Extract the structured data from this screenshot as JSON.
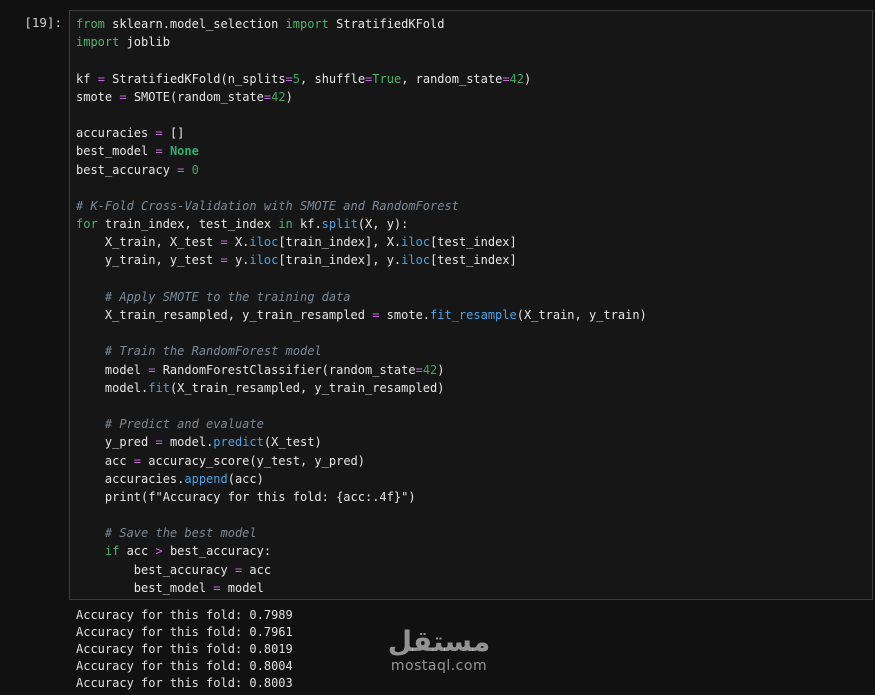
{
  "cell": {
    "prompt": "[19]:",
    "code_lines": [
      [
        [
          "kwc",
          "from"
        ],
        [
          "nm",
          " sklearn.model_selection "
        ],
        [
          "kwc",
          "import"
        ],
        [
          "nm",
          " StratifiedKFold"
        ]
      ],
      [
        [
          "kwc",
          "import"
        ],
        [
          "nm",
          " joblib"
        ]
      ],
      [],
      [
        [
          "nm",
          "kf "
        ],
        [
          "op",
          "="
        ],
        [
          "nm",
          " StratifiedKFold(n_splits"
        ],
        [
          "op",
          "="
        ],
        [
          "num",
          "5"
        ],
        [
          "nm",
          ", shuffle"
        ],
        [
          "op",
          "="
        ],
        [
          "kwc",
          "True"
        ],
        [
          "nm",
          ", random_state"
        ],
        [
          "op",
          "="
        ],
        [
          "num",
          "42"
        ],
        [
          "nm",
          ")"
        ]
      ],
      [
        [
          "nm",
          "smote "
        ],
        [
          "op",
          "="
        ],
        [
          "nm",
          " SMOTE(random_state"
        ],
        [
          "op",
          "="
        ],
        [
          "num",
          "42"
        ],
        [
          "nm",
          ")"
        ]
      ],
      [],
      [
        [
          "nm",
          "accuracies "
        ],
        [
          "op",
          "="
        ],
        [
          "nm",
          " []"
        ]
      ],
      [
        [
          "nm",
          "best_model "
        ],
        [
          "op",
          "="
        ],
        [
          "nm",
          " "
        ],
        [
          "kw",
          "None"
        ]
      ],
      [
        [
          "nm",
          "best_accuracy "
        ],
        [
          "op",
          "="
        ],
        [
          "nm",
          " "
        ],
        [
          "num",
          "0"
        ]
      ],
      [],
      [
        [
          "cm",
          "# K-Fold Cross-Validation with SMOTE and RandomForest"
        ]
      ],
      [
        [
          "kwc",
          "for"
        ],
        [
          "nm",
          " train_index, test_index "
        ],
        [
          "kwc",
          "in"
        ],
        [
          "nm",
          " kf."
        ],
        [
          "fn",
          "split"
        ],
        [
          "nm",
          "(X, y):"
        ]
      ],
      [
        [
          "nm",
          "    X_train, X_test "
        ],
        [
          "op",
          "="
        ],
        [
          "nm",
          " X."
        ],
        [
          "fn",
          "iloc"
        ],
        [
          "nm",
          "[train_index], X."
        ],
        [
          "fn",
          "iloc"
        ],
        [
          "nm",
          "[test_index]"
        ]
      ],
      [
        [
          "nm",
          "    y_train, y_test "
        ],
        [
          "op",
          "="
        ],
        [
          "nm",
          " y."
        ],
        [
          "fn",
          "iloc"
        ],
        [
          "nm",
          "[train_index], y."
        ],
        [
          "fn",
          "iloc"
        ],
        [
          "nm",
          "[test_index]"
        ]
      ],
      [],
      [
        [
          "cm",
          "    # Apply SMOTE to the training data"
        ]
      ],
      [
        [
          "nm",
          "    X_train_resampled, y_train_resampled "
        ],
        [
          "op",
          "="
        ],
        [
          "nm",
          " smote."
        ],
        [
          "fn",
          "fit_resample"
        ],
        [
          "nm",
          "(X_train, y_train)"
        ]
      ],
      [],
      [
        [
          "cm",
          "    # Train the RandomForest model"
        ]
      ],
      [
        [
          "nm",
          "    model "
        ],
        [
          "op",
          "="
        ],
        [
          "nm",
          " RandomForestClassifier(random_state"
        ],
        [
          "op",
          "="
        ],
        [
          "num",
          "42"
        ],
        [
          "nm",
          ")"
        ]
      ],
      [
        [
          "nm",
          "    model."
        ],
        [
          "fn",
          "fit"
        ],
        [
          "nm",
          "(X_train_resampled, y_train_resampled)"
        ]
      ],
      [],
      [
        [
          "cm",
          "    # Predict and evaluate"
        ]
      ],
      [
        [
          "nm",
          "    y_pred "
        ],
        [
          "op",
          "="
        ],
        [
          "nm",
          " model."
        ],
        [
          "fn",
          "predict"
        ],
        [
          "nm",
          "(X_test)"
        ]
      ],
      [
        [
          "nm",
          "    acc "
        ],
        [
          "op",
          "="
        ],
        [
          "nm",
          " accuracy_score(y_test, y_pred)"
        ]
      ],
      [
        [
          "nm",
          "    accuracies."
        ],
        [
          "fn",
          "append"
        ],
        [
          "nm",
          "(acc)"
        ]
      ],
      [
        [
          "nm",
          "    print(f\"Accuracy for this fold: {acc:.4f}\")"
        ]
      ],
      [],
      [
        [
          "cm",
          "    # Save the best model"
        ]
      ],
      [
        [
          "nm",
          "    "
        ],
        [
          "kwc",
          "if"
        ],
        [
          "nm",
          " acc "
        ],
        [
          "op",
          ">"
        ],
        [
          "nm",
          " best_accuracy:"
        ]
      ],
      [
        [
          "nm",
          "        best_accuracy "
        ],
        [
          "op",
          "="
        ],
        [
          "nm",
          " acc"
        ]
      ],
      [
        [
          "nm",
          "        best_model "
        ],
        [
          "op",
          "="
        ],
        [
          "nm",
          " model"
        ]
      ]
    ]
  },
  "output": {
    "lines": [
      "Accuracy for this fold: 0.7989",
      "Accuracy for this fold: 0.7961",
      "Accuracy for this fold: 0.8019",
      "Accuracy for this fold: 0.8004",
      "Accuracy for this fold: 0.8003"
    ]
  },
  "watermark": {
    "arabic": "مستقل",
    "latin": "mostaql.com"
  },
  "colors": {
    "background": "#111111",
    "cell_background": "#161616",
    "keyword": "#4fb36b",
    "operator": "#c46ad8",
    "number": "#3fa35e",
    "comment": "#7a8a99",
    "method": "#4aa3e8"
  }
}
